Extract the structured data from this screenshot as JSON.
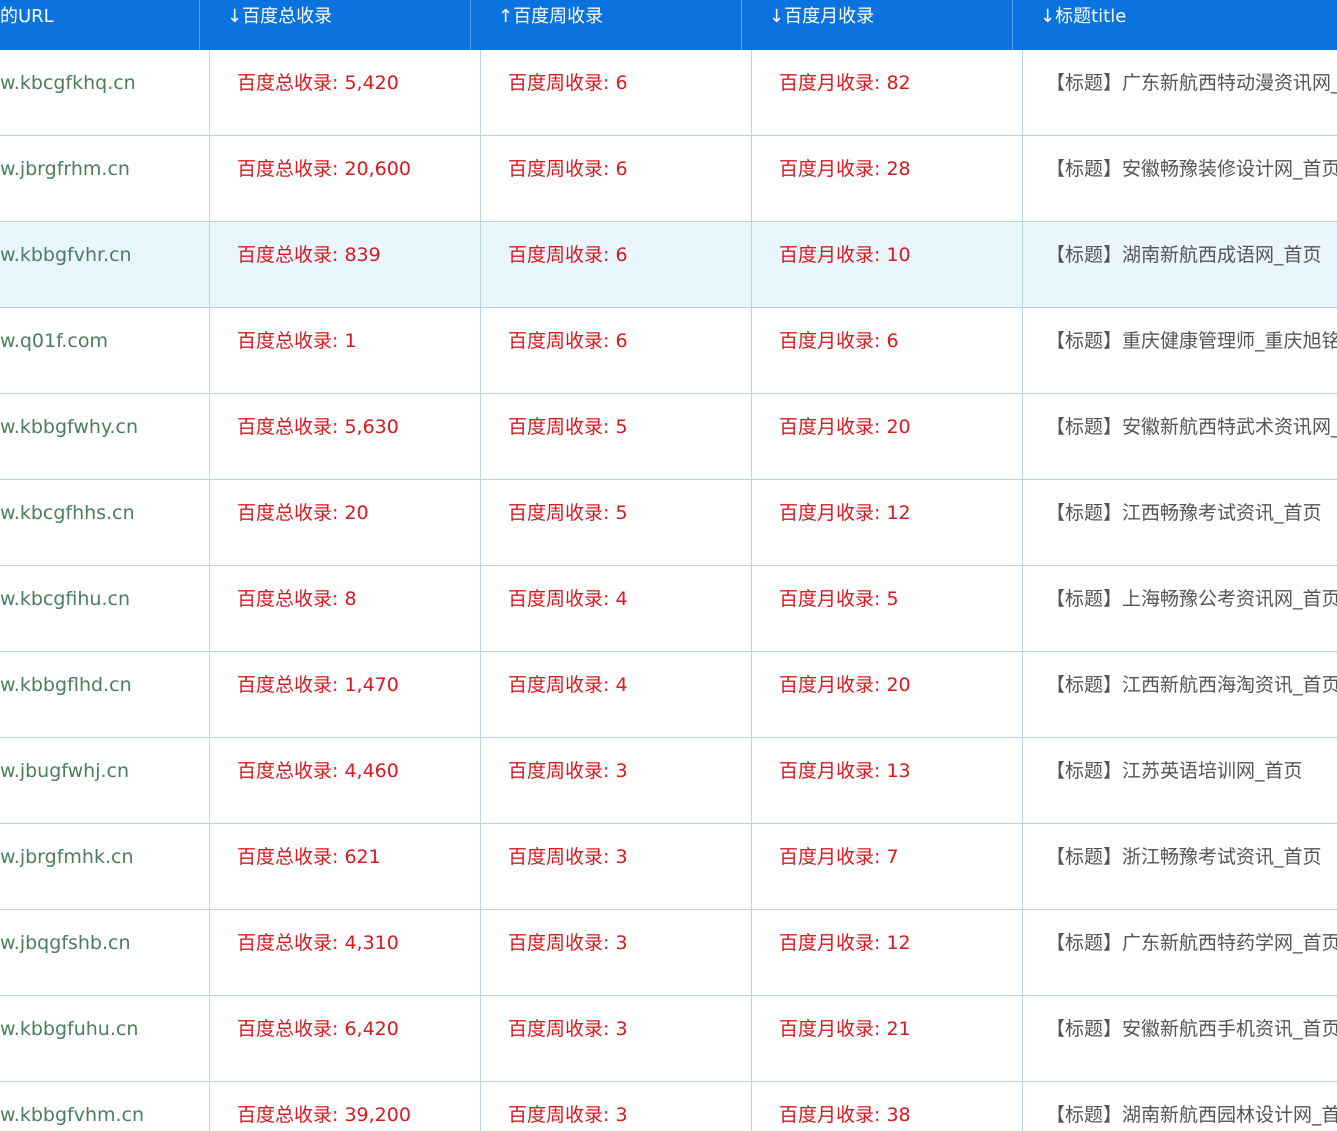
{
  "table": {
    "headers": [
      "的URL",
      "↓百度总收录",
      "↑百度周收录",
      "↓百度月收录",
      "↓标题title"
    ],
    "rows": [
      {
        "url": "w.kbcgfkhq.cn",
        "total": "百度总收录: 5,420",
        "weekly": "百度周收录: 6",
        "monthly": "百度月收录: 82",
        "title": "【标题】广东新航西特动漫资讯网_",
        "highlight": false
      },
      {
        "url": "w.jbrgfrhm.cn",
        "total": "百度总收录: 20,600",
        "weekly": "百度周收录: 6",
        "monthly": "百度月收录: 28",
        "title": "【标题】安徽畅豫装修设计网_首页",
        "highlight": false
      },
      {
        "url": "w.kbbgfvhr.cn",
        "total": "百度总收录: 839",
        "weekly": "百度周收录: 6",
        "monthly": "百度月收录: 10",
        "title": "【标题】湖南新航西成语网_首页",
        "highlight": true
      },
      {
        "url": "w.q01f.com",
        "total": "百度总收录: 1",
        "weekly": "百度周收录: 6",
        "monthly": "百度月收录: 6",
        "title": "【标题】重庆健康管理师_重庆旭铭",
        "highlight": false
      },
      {
        "url": "w.kbbgfwhy.cn",
        "total": "百度总收录: 5,630",
        "weekly": "百度周收录: 5",
        "monthly": "百度月收录: 20",
        "title": "【标题】安徽新航西特武术资讯网_",
        "highlight": false
      },
      {
        "url": "w.kbcgfhhs.cn",
        "total": "百度总收录: 20",
        "weekly": "百度周收录: 5",
        "monthly": "百度月收录: 12",
        "title": "【标题】江西畅豫考试资讯_首页",
        "highlight": false
      },
      {
        "url": "w.kbcgfihu.cn",
        "total": "百度总收录: 8",
        "weekly": "百度周收录: 4",
        "monthly": "百度月收录: 5",
        "title": "【标题】上海畅豫公考资讯网_首页",
        "highlight": false
      },
      {
        "url": "w.kbbgflhd.cn",
        "total": "百度总收录: 1,470",
        "weekly": "百度周收录: 4",
        "monthly": "百度月收录: 20",
        "title": "【标题】江西新航西海淘资讯_首页",
        "highlight": false
      },
      {
        "url": "w.jbugfwhj.cn",
        "total": "百度总收录: 4,460",
        "weekly": "百度周收录: 3",
        "monthly": "百度月收录: 13",
        "title": "【标题】江苏英语培训网_首页",
        "highlight": false
      },
      {
        "url": "w.jbrgfmhk.cn",
        "total": "百度总收录: 621",
        "weekly": "百度周收录: 3",
        "monthly": "百度月收录: 7",
        "title": "【标题】浙江畅豫考试资讯_首页",
        "highlight": false
      },
      {
        "url": "w.jbqgfshb.cn",
        "total": "百度总收录: 4,310",
        "weekly": "百度周收录: 3",
        "monthly": "百度月收录: 12",
        "title": "【标题】广东新航西特药学网_首页",
        "highlight": false
      },
      {
        "url": "w.kbbgfuhu.cn",
        "total": "百度总收录: 6,420",
        "weekly": "百度周收录: 3",
        "monthly": "百度月收录: 21",
        "title": "【标题】安徽新航西手机资讯_首页",
        "highlight": false
      },
      {
        "url": "w.kbbgfvhm.cn",
        "total": "百度总收录: 39,200",
        "weekly": "百度周收录: 3",
        "monthly": "百度月收录: 38",
        "title": "【标题】湖南新航西园林设计网_首",
        "highlight": false
      }
    ]
  },
  "colors": {
    "header_bg": "#0a73e0",
    "url_text": "#4b7d62",
    "metric_text": "#d9191f",
    "title_text": "#555555",
    "row_highlight": "#eaf6fd",
    "grid_line": "#b7d3ea"
  }
}
